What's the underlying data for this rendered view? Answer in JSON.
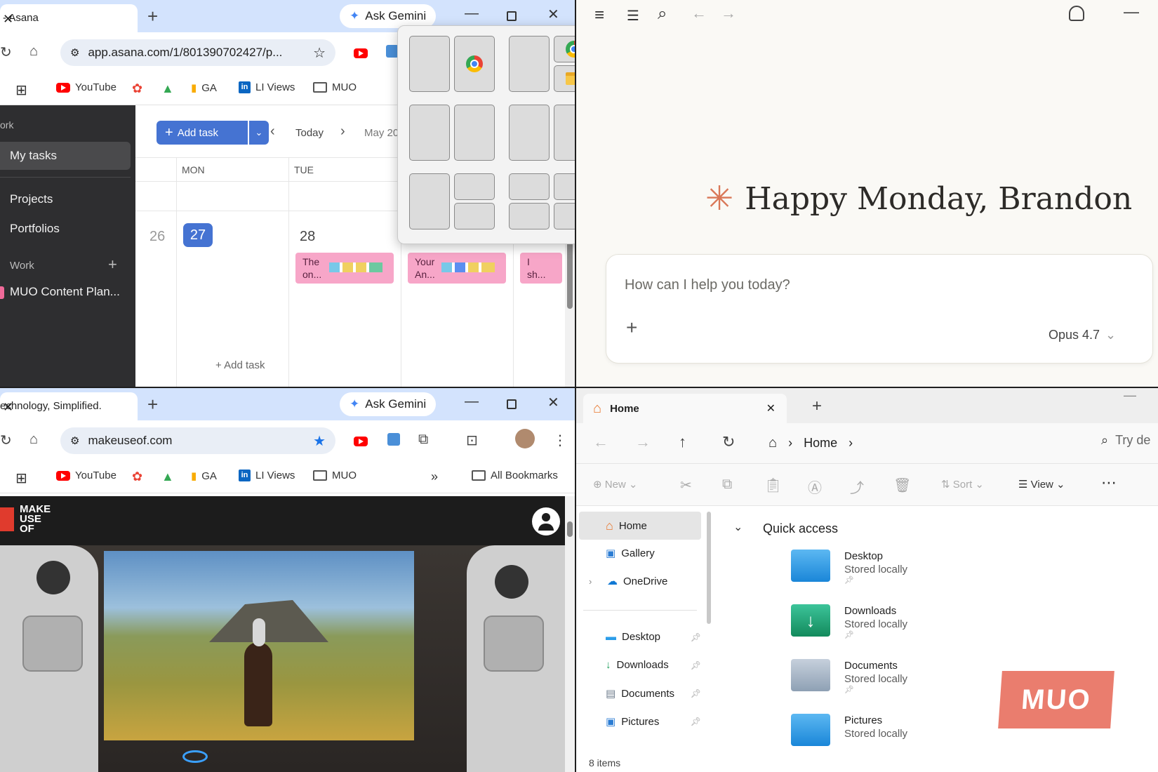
{
  "asana_window": {
    "tab_title": "- Asana",
    "gemini_label": "Ask Gemini",
    "url": "app.asana.com/1/801390702427/p...",
    "bookmarks": [
      "YouTube",
      "GA",
      "LI Views",
      "MUO"
    ],
    "sidebar": {
      "section_label": "ork",
      "items": [
        "My tasks",
        "Projects",
        "Portfolios"
      ],
      "work_label": "Work",
      "project": "MUO Content Plan..."
    },
    "calendar": {
      "add_task": "Add task",
      "today": "Today",
      "month": "May 20",
      "days": [
        "MON",
        "TUE"
      ],
      "dates": [
        "26",
        "27",
        "28"
      ],
      "tasks": [
        {
          "line1": "The",
          "line2": "on..."
        },
        {
          "line1": "Your",
          "line2": "An..."
        },
        {
          "line1": "I",
          "line2": "sh..."
        }
      ],
      "add_task_bottom": "Add task"
    }
  },
  "claude_window": {
    "greeting": "Happy Monday, Brandon",
    "placeholder": "How can I help you today?",
    "model": "Opus 4.7",
    "accent": "#d97757"
  },
  "muo_window": {
    "tab_title": "echnology, Simplified.",
    "gemini_label": "Ask Gemini",
    "url": "makeuseof.com",
    "bookmarks": [
      "YouTube",
      "GA",
      "LI Views",
      "MUO"
    ],
    "all_bookmarks": "All Bookmarks",
    "logo": [
      "MAKE",
      "USE",
      "OF"
    ]
  },
  "explorer_window": {
    "tab_title": "Home",
    "breadcrumb": "Home",
    "search_placeholder": "Try de",
    "commands": {
      "new": "New",
      "sort": "Sort",
      "view": "View"
    },
    "nav": [
      "Home",
      "Gallery",
      "OneDrive"
    ],
    "pinned": [
      "Desktop",
      "Downloads",
      "Documents",
      "Pictures"
    ],
    "quick_access_title": "Quick access",
    "quick_access": [
      {
        "name": "Desktop",
        "sub": "Stored locally"
      },
      {
        "name": "Downloads",
        "sub": "Stored locally"
      },
      {
        "name": "Documents",
        "sub": "Stored locally"
      },
      {
        "name": "Pictures",
        "sub": "Stored locally"
      }
    ],
    "status": "8 items",
    "watermark": "MUO"
  }
}
